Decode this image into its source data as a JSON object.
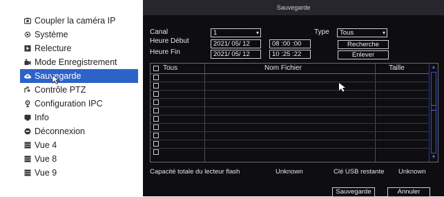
{
  "menu": {
    "items": [
      {
        "label": "Coupler la caméra IP",
        "icon": "camera-icon"
      },
      {
        "label": "Système",
        "icon": "gear-icon"
      },
      {
        "label": "Relecture",
        "icon": "playback-icon"
      },
      {
        "label": "Mode Enregistrement",
        "icon": "record-mode-icon"
      },
      {
        "label": "Sauvegarde",
        "icon": "backup-icon",
        "active": true
      },
      {
        "label": "Contrôle PTZ",
        "icon": "ptz-icon"
      },
      {
        "label": "Configuration IPC",
        "icon": "ipc-config-icon"
      },
      {
        "label": "Info",
        "icon": "info-icon"
      },
      {
        "label": "Déconnexion",
        "icon": "logout-icon"
      },
      {
        "label": "Vue 4",
        "icon": "grid-icon"
      },
      {
        "label": "Vue 8",
        "icon": "grid-icon"
      },
      {
        "label": "Vue 9",
        "icon": "grid-icon"
      }
    ]
  },
  "dialog": {
    "title": "Sauvegarde",
    "canal_label": "Canal",
    "canal_value": "1",
    "type_label": "Type",
    "type_value": "Tous",
    "start_label": "Heure Début",
    "start_date": "2021/ 05/ 12",
    "start_time": "08 :00 :00",
    "end_label": "Heure Fin",
    "end_date": "2021/ 05/ 12",
    "end_time": "10 :25 :22",
    "search_button": "Recherche",
    "remove_button": "Enlever",
    "table": {
      "col_all": "Tous",
      "col_name": "Nom Fichier",
      "col_size": "Taille"
    },
    "capacity_label": "Capacité totale du lecteur flash",
    "capacity_value": "Unknown",
    "usb_label": "Clé USB restante",
    "usb_value": "Unknown",
    "save_button": "Sauvegarde",
    "cancel_button": "Annuler"
  },
  "colors": {
    "accent": "#2d62c9",
    "dialog_bg": "#0e0e12",
    "scrollbar": "#3a4cd8"
  }
}
